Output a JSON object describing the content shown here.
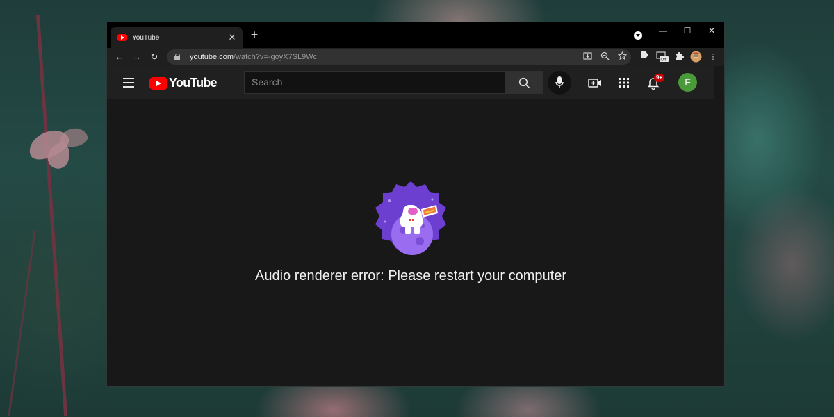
{
  "browser": {
    "tab_title": "YouTube",
    "tab_close": "✕",
    "new_tab": "+",
    "url_host": "youtube.com",
    "url_path": "/watch?v=-goyX7SL9Wc",
    "window_minimize": "—",
    "window_maximize": "☐",
    "window_close": "✕",
    "back": "←",
    "forward": "→",
    "reload": "↻",
    "menu": "⋮"
  },
  "youtube": {
    "logo_text": "YouTube",
    "search_placeholder": "Search",
    "notification_count": "9+",
    "avatar_initial": "F"
  },
  "error": {
    "message": "Audio renderer error: Please restart your computer"
  },
  "colors": {
    "brand_red": "#ff0000",
    "avatar_green": "#4a9a3a",
    "illustration_purple": "#6c3fd1"
  }
}
